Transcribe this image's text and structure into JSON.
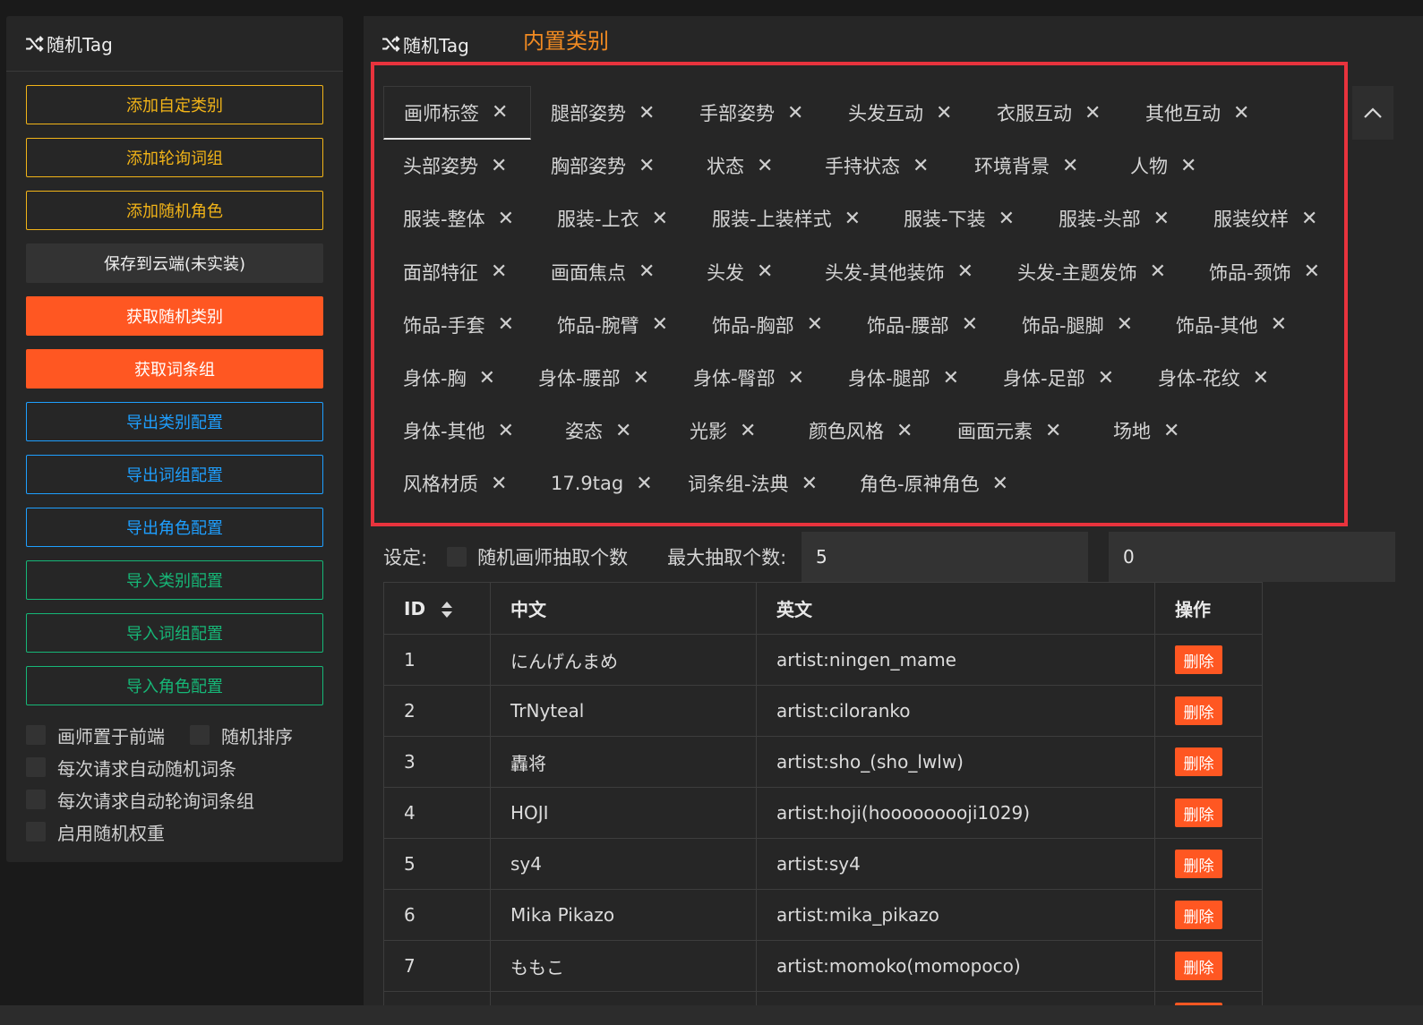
{
  "left": {
    "title": "随机Tag",
    "buttons": [
      {
        "label": "添加自定类别",
        "style": "outline-yellow"
      },
      {
        "label": "添加轮询词组",
        "style": "outline-yellow"
      },
      {
        "label": "添加随机角色",
        "style": "outline-yellow"
      },
      {
        "label": "保存到云端(未实装)",
        "style": "gray"
      },
      {
        "label": "获取随机类别",
        "style": "orange"
      },
      {
        "label": "获取词条组",
        "style": "orange"
      },
      {
        "label": "导出类别配置",
        "style": "outline-blue"
      },
      {
        "label": "导出词组配置",
        "style": "outline-blue"
      },
      {
        "label": "导出角色配置",
        "style": "outline-blue"
      },
      {
        "label": "导入类别配置",
        "style": "outline-teal"
      },
      {
        "label": "导入词组配置",
        "style": "outline-teal"
      },
      {
        "label": "导入角色配置",
        "style": "outline-teal"
      }
    ],
    "checkboxes": {
      "artist_front": "画师置于前端",
      "random_sort": "随机排序",
      "auto_random": "每次请求自动随机词条",
      "auto_poll": "每次请求自动轮询词条组",
      "random_weight": "启用随机权重"
    }
  },
  "right": {
    "title": "随机Tag",
    "builtin_label": "内置类别",
    "tabs": [
      "画师标签",
      "腿部姿势",
      "手部姿势",
      "头发互动",
      "衣服互动",
      "其他互动",
      "头部姿势",
      "胸部姿势",
      "状态",
      "手持状态",
      "环境背景",
      "人物",
      "服装-整体",
      "服装-上衣",
      "服装-上装样式",
      "服装-下装",
      "服装-头部",
      "服装纹样",
      "面部特征",
      "画面焦点",
      "头发",
      "头发-其他装饰",
      "头发-主题发饰",
      "饰品-颈饰",
      "饰品-手套",
      "饰品-腕臂",
      "饰品-胸部",
      "饰品-腰部",
      "饰品-腿脚",
      "饰品-其他",
      "身体-胸",
      "身体-腰部",
      "身体-臀部",
      "身体-腿部",
      "身体-足部",
      "身体-花纹",
      "身体-其他",
      "姿态",
      "光影",
      "颜色风格",
      "画面元素",
      "场地",
      "风格材质",
      "17.9tag",
      "词条组-法典",
      "角色-原神角色"
    ],
    "active_tab": "画师标签",
    "settings": {
      "label": "设定:",
      "random_artist": "随机画师抽取个数",
      "max_label": "最大抽取个数:",
      "max_value": "5",
      "second_value": "0"
    },
    "table": {
      "headers": {
        "id": "ID",
        "cn": "中文",
        "en": "英文",
        "op": "操作"
      },
      "delete_label": "删除",
      "rows": [
        {
          "id": "1",
          "cn": "にんげんまめ",
          "en": "artist:ningen_mame"
        },
        {
          "id": "2",
          "cn": "TrNyteal",
          "en": "artist:ciloranko"
        },
        {
          "id": "3",
          "cn": "轟将",
          "en": "artist:sho_(sho_lwlw)"
        },
        {
          "id": "4",
          "cn": "HOJI",
          "en": "artist:hoji(hooooooooji1029)"
        },
        {
          "id": "5",
          "cn": "sy4",
          "en": "artist:sy4"
        },
        {
          "id": "6",
          "cn": "Mika Pikazo",
          "en": "artist:mika_pikazo"
        },
        {
          "id": "7",
          "cn": "ももこ",
          "en": "artist:momoko(momopoco)"
        },
        {
          "id": "",
          "cn": "",
          "en": ""
        }
      ]
    }
  },
  "colors": {
    "accent_orange": "#ff5722",
    "yellow": "#f2b418",
    "blue": "#1e9fff",
    "teal": "#16b777",
    "highlight_red": "#e8333d"
  }
}
